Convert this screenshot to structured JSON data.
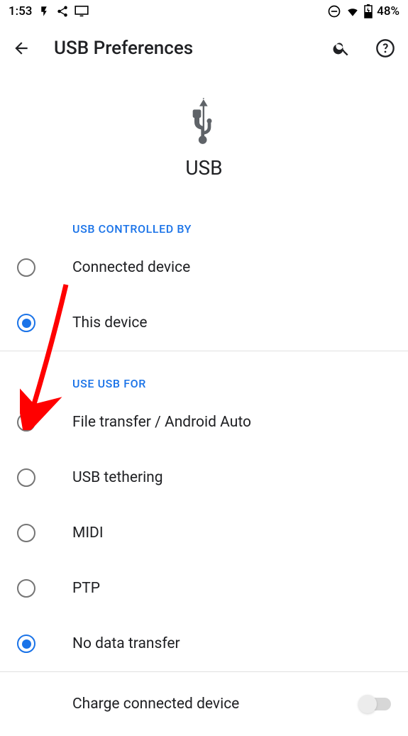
{
  "status": {
    "time": "1:53",
    "battery": "48%"
  },
  "appbar": {
    "title": "USB Preferences"
  },
  "hero": {
    "label": "USB"
  },
  "sections": {
    "controlled_by": {
      "header": "USB CONTROLLED BY",
      "options": [
        {
          "label": "Connected device",
          "checked": false
        },
        {
          "label": "This device",
          "checked": true
        }
      ]
    },
    "use_for": {
      "header": "USE USB FOR",
      "options": [
        {
          "label": "File transfer / Android Auto",
          "checked": false
        },
        {
          "label": "USB tethering",
          "checked": false
        },
        {
          "label": "MIDI",
          "checked": false
        },
        {
          "label": "PTP",
          "checked": false
        },
        {
          "label": "No data transfer",
          "checked": true
        }
      ]
    }
  },
  "charge_switch": {
    "label": "Charge connected device",
    "on": false
  }
}
